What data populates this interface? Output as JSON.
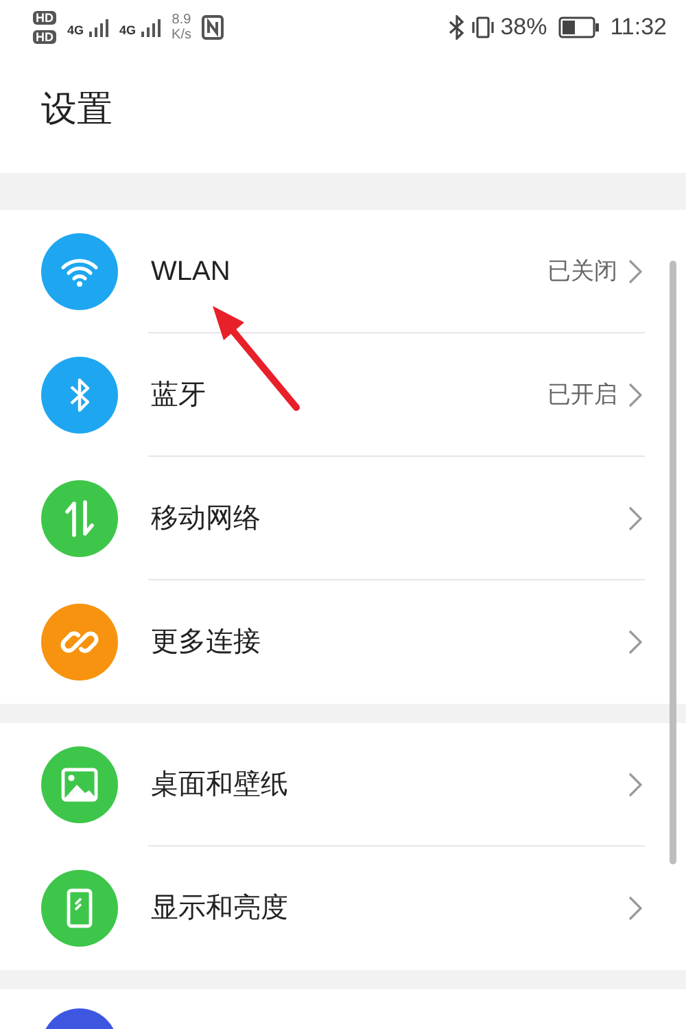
{
  "status_bar": {
    "sim_labels": [
      "HD",
      "HD"
    ],
    "network_labels": [
      "4G",
      "4G"
    ],
    "speed": "8.9",
    "speed_unit": "K/s",
    "battery": "38%",
    "time": "11:32"
  },
  "title": "设置",
  "groups": [
    {
      "items": [
        {
          "kind": "wifi",
          "color": "#1ea7f0",
          "label": "WLAN",
          "value": "已关闭"
        },
        {
          "kind": "bluetooth",
          "color": "#1ea7f0",
          "label": "蓝牙",
          "value": "已开启"
        },
        {
          "kind": "mobile",
          "color": "#3ec64a",
          "label": "移动网络"
        },
        {
          "kind": "link",
          "color": "#f7930f",
          "label": "更多连接"
        }
      ]
    },
    {
      "items": [
        {
          "kind": "wallpaper",
          "color": "#3ec64a",
          "label": "桌面和壁纸"
        },
        {
          "kind": "display",
          "color": "#3ec64a",
          "label": "显示和亮度"
        }
      ]
    },
    {
      "items": [
        {
          "kind": "partial",
          "color": "#3d57e0"
        }
      ]
    }
  ]
}
